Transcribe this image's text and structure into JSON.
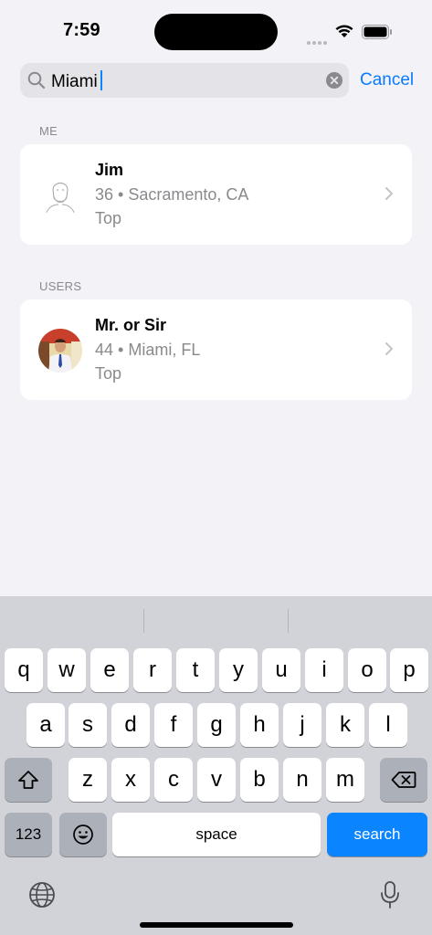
{
  "status_bar": {
    "time": "7:59"
  },
  "search": {
    "query": "Miami",
    "cancel_label": "Cancel"
  },
  "sections": [
    {
      "header": "ME",
      "item": {
        "name": "Jim",
        "meta": "36 • Sacramento, CA",
        "tag": "Top"
      }
    },
    {
      "header": "USERS",
      "item": {
        "name": "Mr. or Sir",
        "meta": "44 • Miami, FL",
        "tag": "Top"
      }
    }
  ],
  "keyboard": {
    "row1": [
      "q",
      "w",
      "e",
      "r",
      "t",
      "y",
      "u",
      "i",
      "o",
      "p"
    ],
    "row2": [
      "a",
      "s",
      "d",
      "f",
      "g",
      "h",
      "j",
      "k",
      "l"
    ],
    "row3": [
      "z",
      "x",
      "c",
      "v",
      "b",
      "n",
      "m"
    ],
    "numbers_label": "123",
    "space_label": "space",
    "search_label": "search",
    "icons": [
      "shift-icon",
      "delete-icon",
      "emoji-icon",
      "globe-icon",
      "microphone-icon"
    ]
  },
  "colors": {
    "accent": "#0a84ff",
    "background": "#f2f2f7",
    "keyboard": "#d1d3d9"
  }
}
